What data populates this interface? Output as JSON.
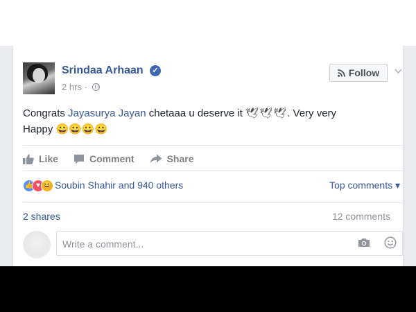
{
  "post": {
    "author": "Srindaa Arhaan",
    "time": "2 hrs",
    "meta_sep": "·",
    "follow_label": "Follow",
    "text_before": "Congrats ",
    "mention": "Jayasurya Jayan",
    "text_after": " chetaaa u deserve it ",
    "glyphs": "🕊🕊🕊",
    "text_tail": ". Very very",
    "text_line2": "Happy 😀😀😀😀"
  },
  "actions": {
    "like": "Like",
    "comment": "Comment",
    "share": "Share"
  },
  "reactions": {
    "summary": "Soubin Shahir and 940 others",
    "top_comments": "Top comments ▾"
  },
  "stats": {
    "shares": "2 shares",
    "comments": "12 comments"
  },
  "comment_box": {
    "placeholder": "Write a comment..."
  },
  "icons": [
    "verified-badge-icon",
    "globe-icon",
    "rss-icon",
    "chevron-down-icon",
    "like-icon",
    "comment-icon",
    "share-icon",
    "camera-icon",
    "smiley-icon"
  ],
  "colors": {
    "link": "#365899",
    "like_reaction": "#5890ff",
    "love_reaction": "#f25268",
    "haha_reaction": "#f7b125"
  }
}
